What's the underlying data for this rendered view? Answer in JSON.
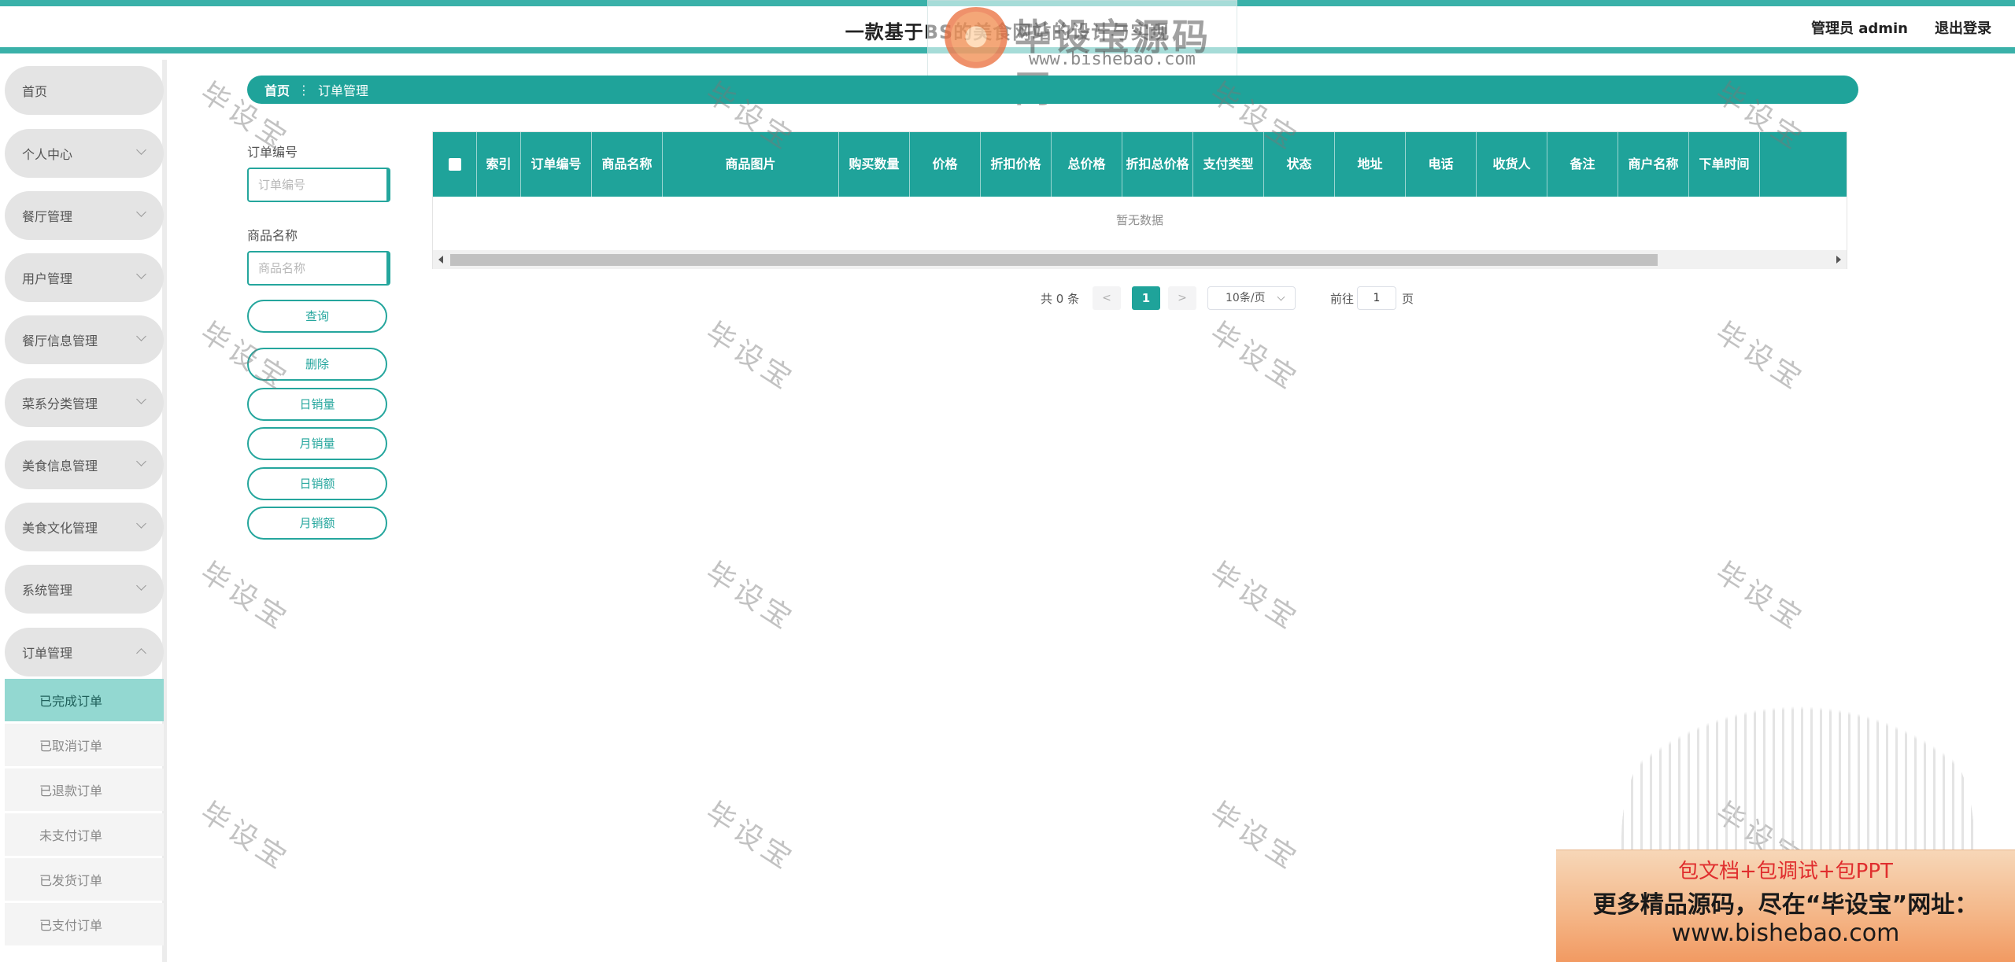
{
  "header": {
    "title": "一款基于BS的美食网站的设计与实现",
    "admin_label": "管理员 admin",
    "logout_label": "退出登录"
  },
  "logo_watermark": {
    "name": "毕设宝源码网",
    "url": "www.bishebao.com"
  },
  "sidebar": {
    "items": [
      {
        "label": "首页",
        "has_arrow": false
      },
      {
        "label": "个人中心",
        "has_arrow": true
      },
      {
        "label": "餐厅管理",
        "has_arrow": true
      },
      {
        "label": "用户管理",
        "has_arrow": true
      },
      {
        "label": "餐厅信息管理",
        "has_arrow": true
      },
      {
        "label": "菜系分类管理",
        "has_arrow": true
      },
      {
        "label": "美食信息管理",
        "has_arrow": true
      },
      {
        "label": "美食文化管理",
        "has_arrow": true
      },
      {
        "label": "系统管理",
        "has_arrow": true
      },
      {
        "label": "订单管理",
        "has_arrow": true,
        "expanded": true
      }
    ],
    "sub_items": [
      {
        "label": "已完成订单",
        "active": true
      },
      {
        "label": "已取消订单",
        "active": false
      },
      {
        "label": "已退款订单",
        "active": false
      },
      {
        "label": "未支付订单",
        "active": false
      },
      {
        "label": "已发货订单",
        "active": false
      },
      {
        "label": "已支付订单",
        "active": false
      }
    ]
  },
  "breadcrumb": {
    "home": "首页",
    "separator": "⋮",
    "current": "订单管理"
  },
  "filters": {
    "order_no": {
      "label": "订单编号",
      "placeholder": "订单编号",
      "value": ""
    },
    "product_name": {
      "label": "商品名称",
      "placeholder": "商品名称",
      "value": ""
    },
    "query_label": "查询",
    "buttons": [
      "删除",
      "日销量",
      "月销量",
      "日销额",
      "月销额"
    ]
  },
  "table": {
    "columns": [
      "索引",
      "订单编号",
      "商品名称",
      "商品图片",
      "购买数量",
      "价格",
      "折扣价格",
      "总价格",
      "折扣总价格",
      "支付类型",
      "状态",
      "地址",
      "电话",
      "收货人",
      "备注",
      "商户名称",
      "下单时间"
    ],
    "rows": [],
    "empty_text": "暂无数据"
  },
  "pagination": {
    "total_text": "共 0 条",
    "prev_icon": "<",
    "current_page": "1",
    "next_icon": ">",
    "page_size_text": "10条/页",
    "goto_label": "前往",
    "goto_value": "1",
    "goto_suffix": "页"
  },
  "watermark_text": "毕设宝",
  "ad_banner": {
    "line1": "包文档+包调试+包PPT",
    "line2": "更多精品源码，尽在“毕设宝”网址：",
    "line3": "www.bishebao.com"
  },
  "colors": {
    "primary": "#1fa39a",
    "top_border": "#3ab1a9",
    "active_submenu": "#93d8d1",
    "menu_bg": "#e4e4e4"
  }
}
